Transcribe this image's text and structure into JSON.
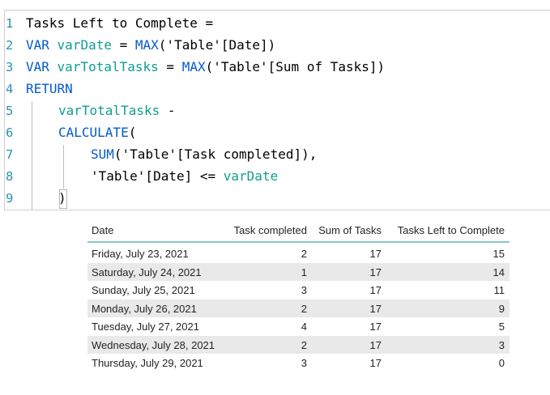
{
  "editor": {
    "lines": [
      {
        "num": "1"
      },
      {
        "num": "2"
      },
      {
        "num": "3"
      },
      {
        "num": "4"
      },
      {
        "num": "5"
      },
      {
        "num": "6"
      },
      {
        "num": "7"
      },
      {
        "num": "8"
      },
      {
        "num": "9"
      }
    ],
    "tokens": {
      "l1": "Tasks Left to Complete =",
      "l2_var": "VAR",
      "l2_name": "varDate",
      "l2_eq": " = ",
      "l2_fn": "MAX",
      "l2_arg": "('Table'[Date])",
      "l3_var": "VAR",
      "l3_name": "varTotalTasks",
      "l3_eq": " = ",
      "l3_fn": "MAX",
      "l3_arg": "('Table'[Sum of Tasks])",
      "l4_ret": "RETURN",
      "l5_name": "varTotalTasks",
      "l5_op": " -",
      "l6_fn": "CALCULATE",
      "l6_paren": "(",
      "l7_fn": "SUM",
      "l7_arg": "('Table'[Task completed]),",
      "l8_col": "'Table'[Date] <= ",
      "l8_name": "varDate",
      "l9_paren": ")"
    }
  },
  "table": {
    "headers": [
      "Date",
      "Task completed",
      "Sum of Tasks",
      "Tasks Left to Complete"
    ],
    "rows": [
      {
        "date": "Friday, July 23, 2021",
        "completed": "2",
        "sum": "17",
        "left": "15"
      },
      {
        "date": "Saturday, July 24, 2021",
        "completed": "1",
        "sum": "17",
        "left": "14"
      },
      {
        "date": "Sunday, July 25, 2021",
        "completed": "3",
        "sum": "17",
        "left": "11"
      },
      {
        "date": "Monday, July 26, 2021",
        "completed": "2",
        "sum": "17",
        "left": "9"
      },
      {
        "date": "Tuesday, July 27, 2021",
        "completed": "4",
        "sum": "17",
        "left": "5"
      },
      {
        "date": "Wednesday, July 28, 2021",
        "completed": "2",
        "sum": "17",
        "left": "3"
      },
      {
        "date": "Thursday, July 29, 2021",
        "completed": "3",
        "sum": "17",
        "left": "0"
      }
    ],
    "colors": {
      "header_rule": "#86c9c3",
      "alt_row": "#e9e9e9"
    }
  },
  "syntax_colors": {
    "keyword": "#035aca",
    "variable": "#0f9d94",
    "line_number": "#2b91af"
  }
}
